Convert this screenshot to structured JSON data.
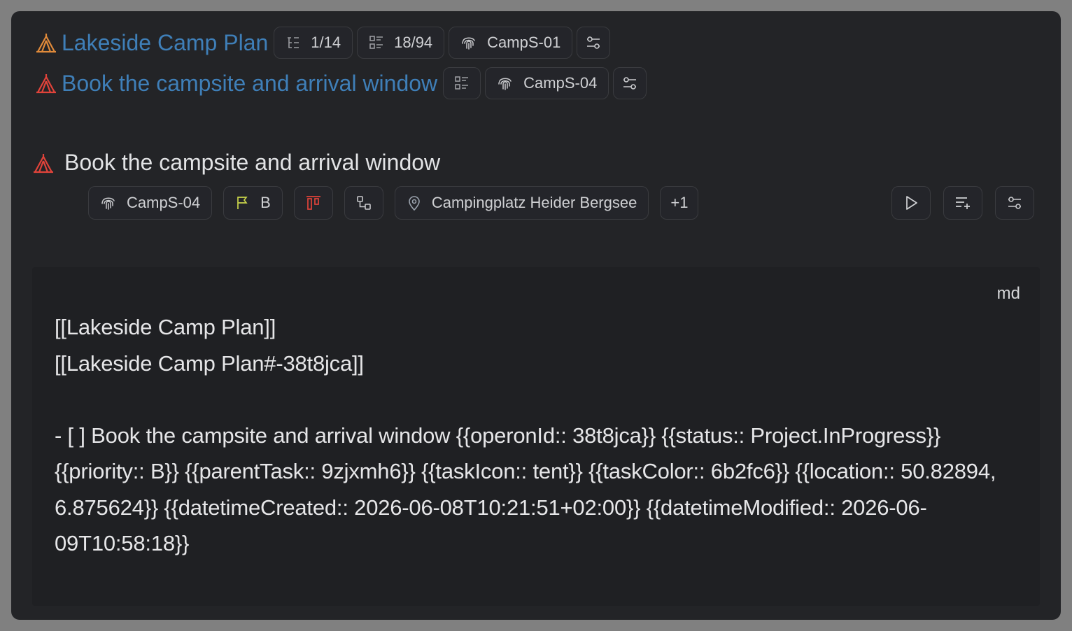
{
  "breadcrumbs": [
    {
      "title": "Lakeside Camp Plan",
      "icon": "tent-icon",
      "icon_color": "#e08a3a",
      "subtasks_count": "1/14",
      "checklist_count": "18/94",
      "id": "CampS-01"
    },
    {
      "title": "Book the campsite and arrival window",
      "icon": "tent-icon",
      "icon_color": "#e0433a",
      "id": "CampS-04"
    }
  ],
  "task": {
    "title": "Book the campsite and arrival window",
    "icon": "tent-icon",
    "icon_color": "#e0433a",
    "id": "CampS-04",
    "priority": "B",
    "location": "Campingplatz Heider Bergsee",
    "more": "+1"
  },
  "code_block": {
    "language": "md",
    "content": "[[Lakeside Camp Plan]]\n[[Lakeside Camp Plan#-38t8jca]]\n\n- [ ] Book the campsite and arrival window {{operonId:: 38t8jca}} {{status:: Project.InProgress}} {{priority:: B}} {{parentTask:: 9zjxmh6}} {{taskIcon:: tent}} {{taskColor:: 6b2fc6}} {{location:: 50.82894, 6.875624}} {{datetimeCreated:: 2026-06-08T10:21:51+02:00}} {{datetimeModified:: 2026-06-09T10:58:18}}"
  },
  "colors": {
    "link": "#3f7fb8",
    "priority_flag": "#c8d44a",
    "status_red": "#e0433a",
    "background": "#232427"
  }
}
